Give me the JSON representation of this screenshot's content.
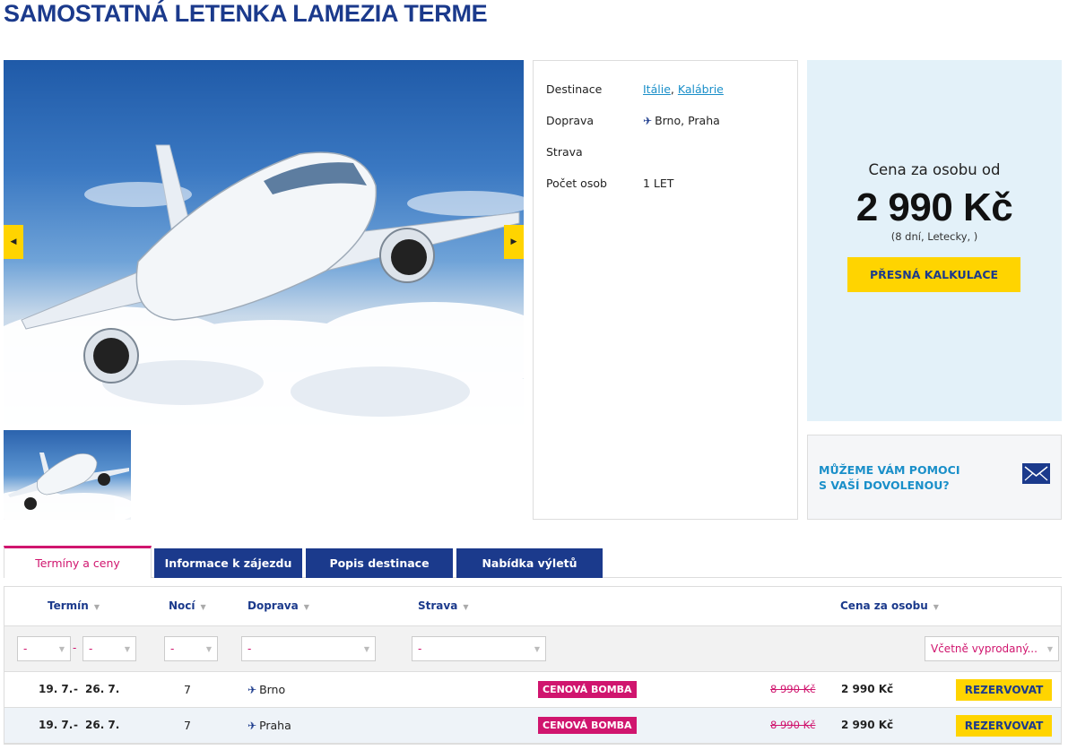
{
  "title": "SAMOSTATNÁ LETENKA LAMEZIA TERME",
  "gallery": {
    "prev_icon": "caret-left-icon",
    "next_icon": "caret-right-icon"
  },
  "info": {
    "destination_label": "Destinace",
    "destination_country": "Itálie",
    "destination_sep": ",",
    "destination_region": "Kalábrie",
    "transport_label": "Doprava",
    "transport_value": "Brno, Praha",
    "board_label": "Strava",
    "persons_label": "Počet osob",
    "persons_value": "1 LET"
  },
  "price": {
    "label": "Cena za osobu od",
    "value": "2 990 Kč",
    "note": "(8 dní, Letecky, )",
    "button": "PŘESNÁ KALKULACE"
  },
  "help": {
    "line1": "MŮŽEME VÁM POMOCI",
    "line2": "S VAŠÍ DOVOLENOU?"
  },
  "tabs": [
    {
      "label": "Termíny a ceny",
      "active": true
    },
    {
      "label": "Informace k zájezdu",
      "active": false
    },
    {
      "label": "Popis destinace",
      "active": false
    },
    {
      "label": "Nabídka výletů",
      "active": false
    }
  ],
  "table": {
    "headers": {
      "term": "Termín",
      "nights": "Nocí",
      "transport": "Doprava",
      "board": "Strava",
      "price": "Cena za osobu"
    },
    "filters": {
      "date_from": "-",
      "date_sep": "-",
      "date_to": "-",
      "nights": "-",
      "transport": "-",
      "board": "-",
      "availability": "Včetně vyprodaný..."
    },
    "rows": [
      {
        "from": "19. 7.",
        "sep": "-",
        "to": "26. 7.",
        "nights": "7",
        "transport": "Brno",
        "badge": "CENOVÁ BOMBA",
        "old_price": "8 990 Kč",
        "price": "2 990 Kč",
        "button": "REZERVOVAT"
      },
      {
        "from": "19. 7.",
        "sep": "-",
        "to": "26. 7.",
        "nights": "7",
        "transport": "Praha",
        "badge": "CENOVÁ BOMBA",
        "old_price": "8 990 Kč",
        "price": "2 990 Kč",
        "button": "REZERVOVAT"
      }
    ]
  },
  "colors": {
    "brand_blue": "#1b3a8c",
    "accent_yellow": "#ffd400",
    "accent_magenta": "#d0156e",
    "link_blue": "#1a8fc9",
    "price_panel_bg": "#e3f1f9"
  }
}
